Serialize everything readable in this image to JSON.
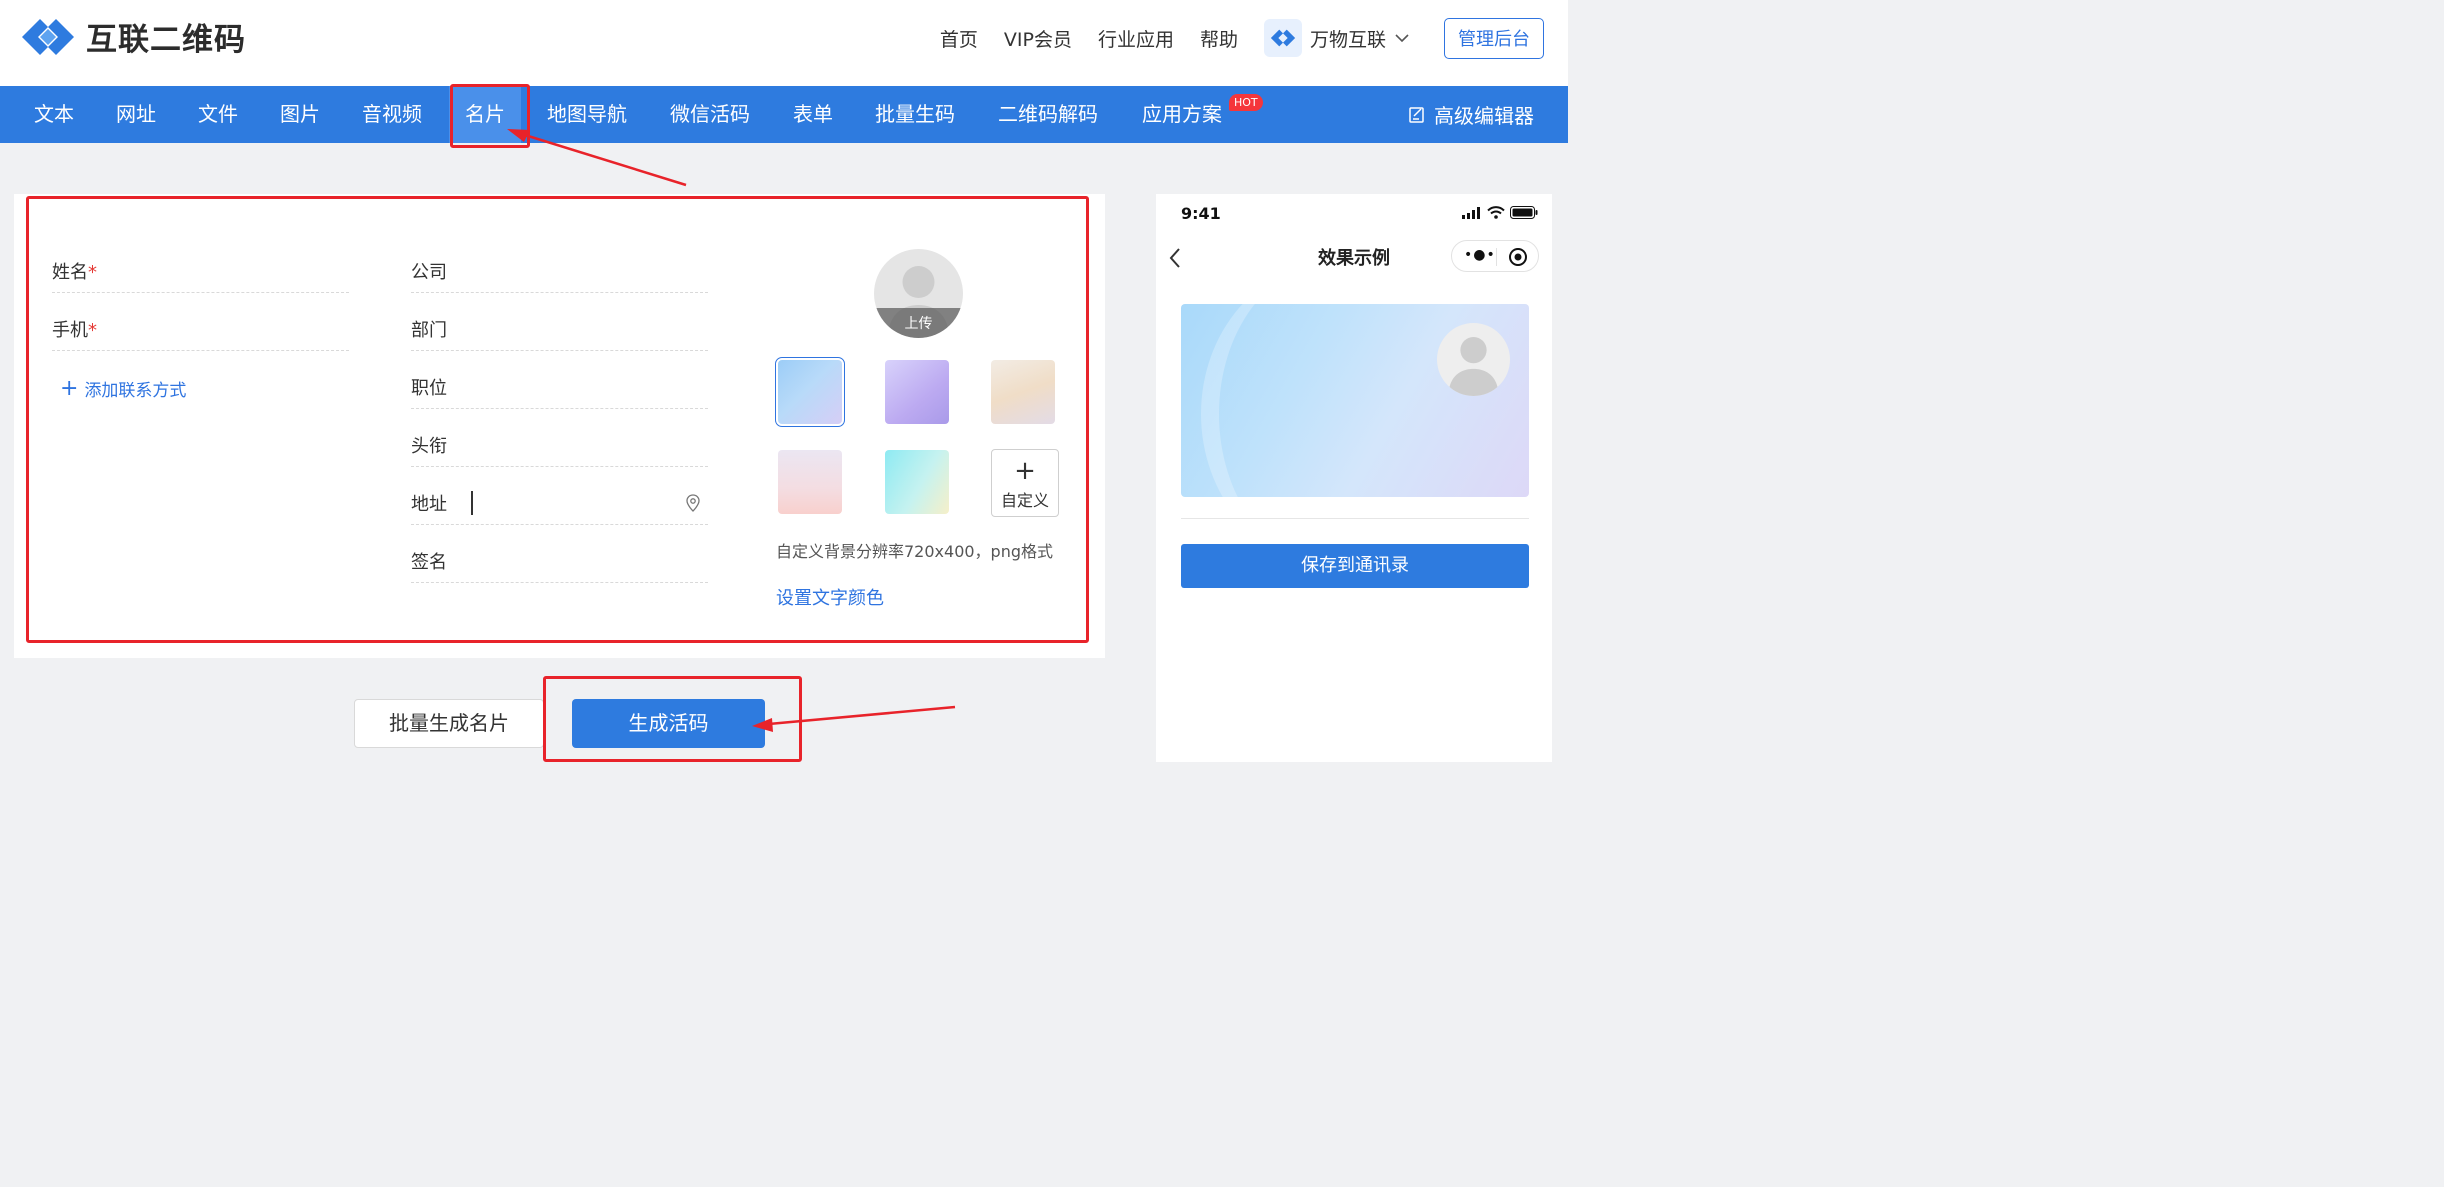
{
  "brand": {
    "name": "互联二维码",
    "accent": "#2e7bdf"
  },
  "header": {
    "links": [
      "首页",
      "VIP会员",
      "行业应用",
      "帮助"
    ],
    "workspace": "万物互联",
    "admin_button": "管理后台"
  },
  "nav": {
    "items": [
      "文本",
      "网址",
      "文件",
      "图片",
      "音视频",
      "名片",
      "地图导航",
      "微信活码",
      "表单",
      "批量生码",
      "二维码解码",
      "应用方案"
    ],
    "active": "名片",
    "hot_badge": "HOT",
    "advanced_editor": "高级编辑器"
  },
  "form": {
    "name_label": "姓名",
    "phone_label": "手机",
    "required_mark": "*",
    "add_contact": "添加联系方式",
    "company_label": "公司",
    "department_label": "部门",
    "position_label": "职位",
    "title_label": "头衔",
    "address_label": "地址",
    "signature_label": "签名",
    "upload_label": "上传",
    "custom_bg": "自定义",
    "custom_bg_hint": "自定义背景分辨率720x400，png格式",
    "set_text_color": "设置文字颜色"
  },
  "actions": {
    "batch_button": "批量生成名片",
    "generate_button": "生成活码"
  },
  "preview": {
    "status_time": "9:41",
    "title": "效果示例",
    "save_button": "保存到通讯录"
  },
  "colors": {
    "nav_bg": "#2e7bdf",
    "link": "#2f74e0",
    "annotation_red": "#e8232a",
    "hot_badge": "#f5363b"
  }
}
